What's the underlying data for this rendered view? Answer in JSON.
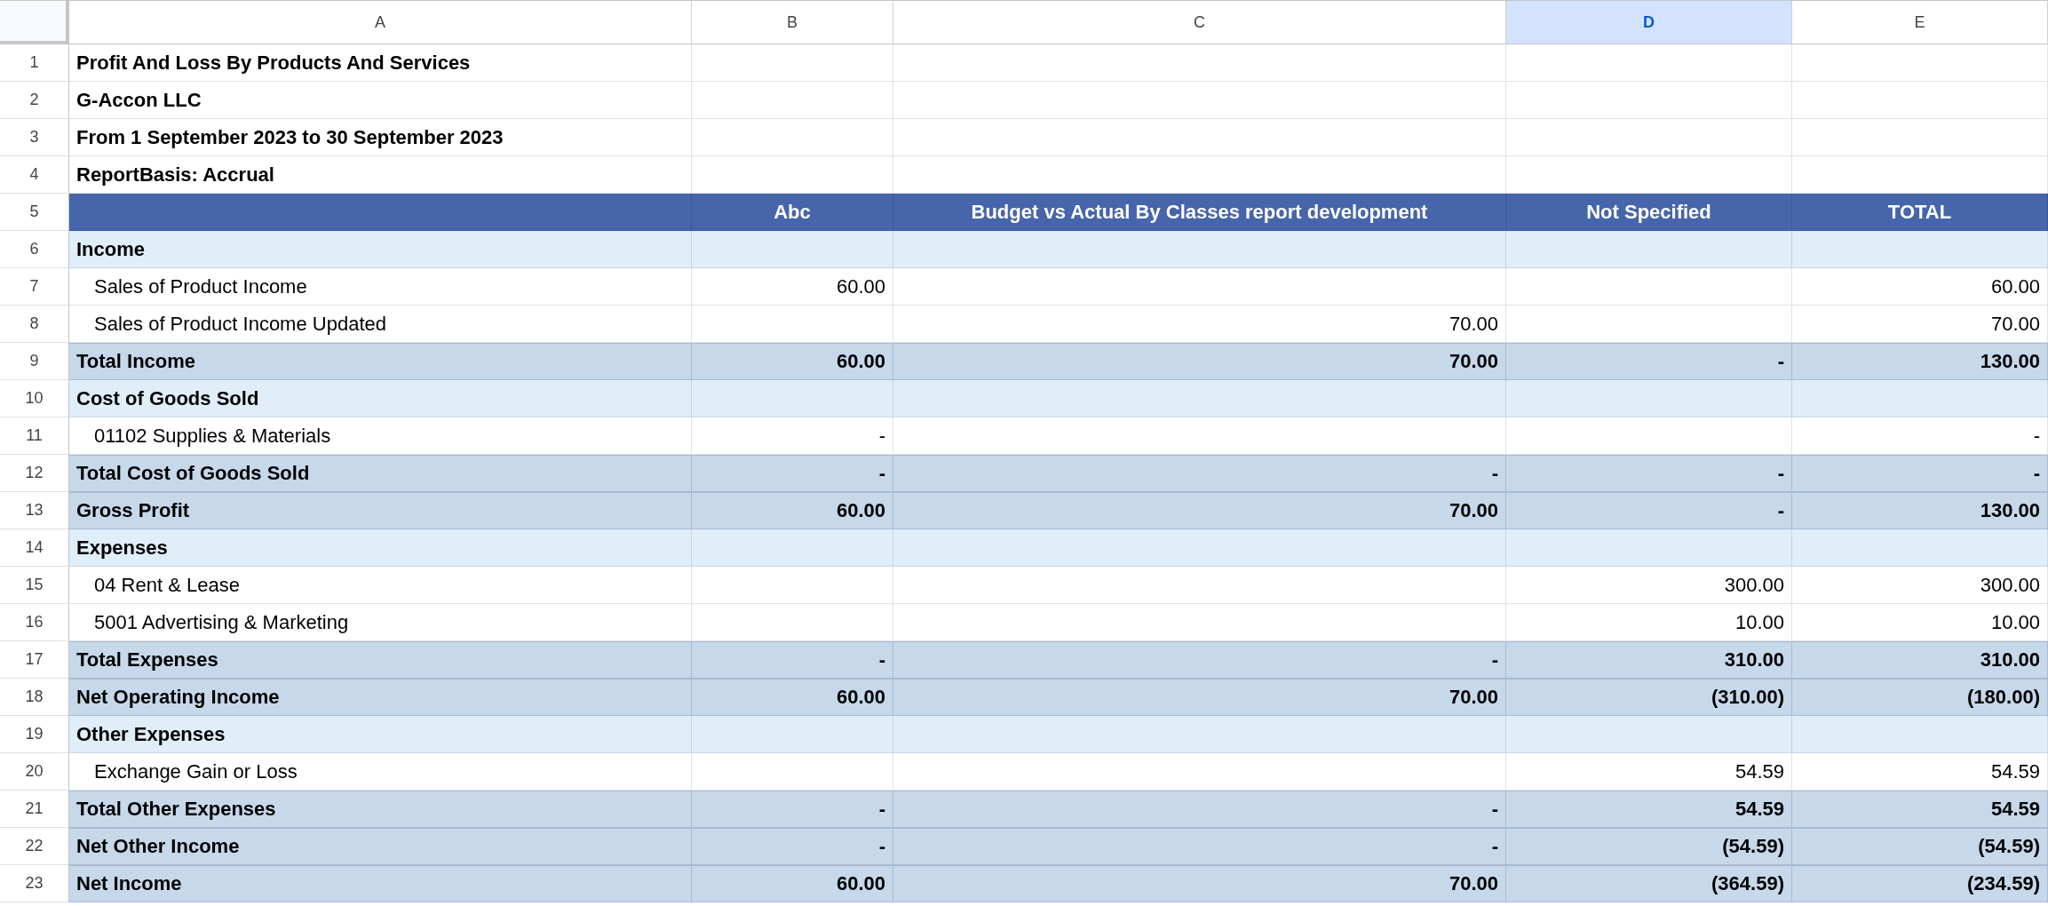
{
  "columns": [
    {
      "label": "A",
      "selected": false
    },
    {
      "label": "B",
      "selected": false
    },
    {
      "label": "C",
      "selected": false
    },
    {
      "label": "D",
      "selected": true
    },
    {
      "label": "E",
      "selected": false
    }
  ],
  "rows": [
    {
      "number": "1",
      "kind": "title",
      "a": "Profit And Loss By Products And Services"
    },
    {
      "number": "2",
      "kind": "title",
      "a": "G-Accon LLC"
    },
    {
      "number": "3",
      "kind": "title",
      "a": "From 1 September 2023 to 30 September 2023"
    },
    {
      "number": "4",
      "kind": "title",
      "a": "ReportBasis: Accrual"
    },
    {
      "number": "5",
      "kind": "header",
      "b": "Abc",
      "c": "Budget vs Actual By Classes report development",
      "d": "Not Specified",
      "e": "TOTAL"
    },
    {
      "number": "6",
      "kind": "section",
      "a": "Income"
    },
    {
      "number": "7",
      "kind": "item",
      "a": "Sales of Product Income",
      "b": "60.00",
      "e": "60.00"
    },
    {
      "number": "8",
      "kind": "item",
      "a": "Sales of Product Income Updated",
      "c": "70.00",
      "e": "70.00"
    },
    {
      "number": "9",
      "kind": "total",
      "a": "Total Income",
      "b": "60.00",
      "c": "70.00",
      "d": "-",
      "e": "130.00"
    },
    {
      "number": "10",
      "kind": "section",
      "a": "Cost of Goods Sold"
    },
    {
      "number": "11",
      "kind": "item",
      "a": "01102 Supplies & Materials",
      "b": "-",
      "e": "-"
    },
    {
      "number": "12",
      "kind": "total",
      "a": "Total Cost of Goods Sold",
      "b": "-",
      "c": "-",
      "d": "-",
      "e": "-"
    },
    {
      "number": "13",
      "kind": "total",
      "a": "Gross Profit",
      "b": "60.00",
      "c": "70.00",
      "d": "-",
      "e": "130.00"
    },
    {
      "number": "14",
      "kind": "section",
      "a": "Expenses"
    },
    {
      "number": "15",
      "kind": "item",
      "a": "04 Rent & Lease",
      "d": "300.00",
      "e": "300.00"
    },
    {
      "number": "16",
      "kind": "item",
      "a": "5001 Advertising & Marketing",
      "d": "10.00",
      "e": "10.00"
    },
    {
      "number": "17",
      "kind": "total",
      "a": "Total Expenses",
      "b": "-",
      "c": "-",
      "d": "310.00",
      "e": "310.00"
    },
    {
      "number": "18",
      "kind": "total",
      "a": "Net Operating Income",
      "b": "60.00",
      "c": "70.00",
      "d": "(310.00)",
      "e": "(180.00)"
    },
    {
      "number": "19",
      "kind": "section",
      "a": "Other Expenses"
    },
    {
      "number": "20",
      "kind": "item",
      "a": "Exchange Gain or Loss",
      "d": "54.59",
      "e": "54.59"
    },
    {
      "number": "21",
      "kind": "total",
      "a": "Total Other Expenses",
      "b": "-",
      "c": "-",
      "d": "54.59",
      "e": "54.59"
    },
    {
      "number": "22",
      "kind": "total",
      "a": "Net Other Income",
      "b": "-",
      "c": "-",
      "d": "(54.59)",
      "e": "(54.59)"
    },
    {
      "number": "23",
      "kind": "total",
      "a": "Net Income",
      "b": "60.00",
      "c": "70.00",
      "d": "(364.59)",
      "e": "(234.59)"
    }
  ]
}
